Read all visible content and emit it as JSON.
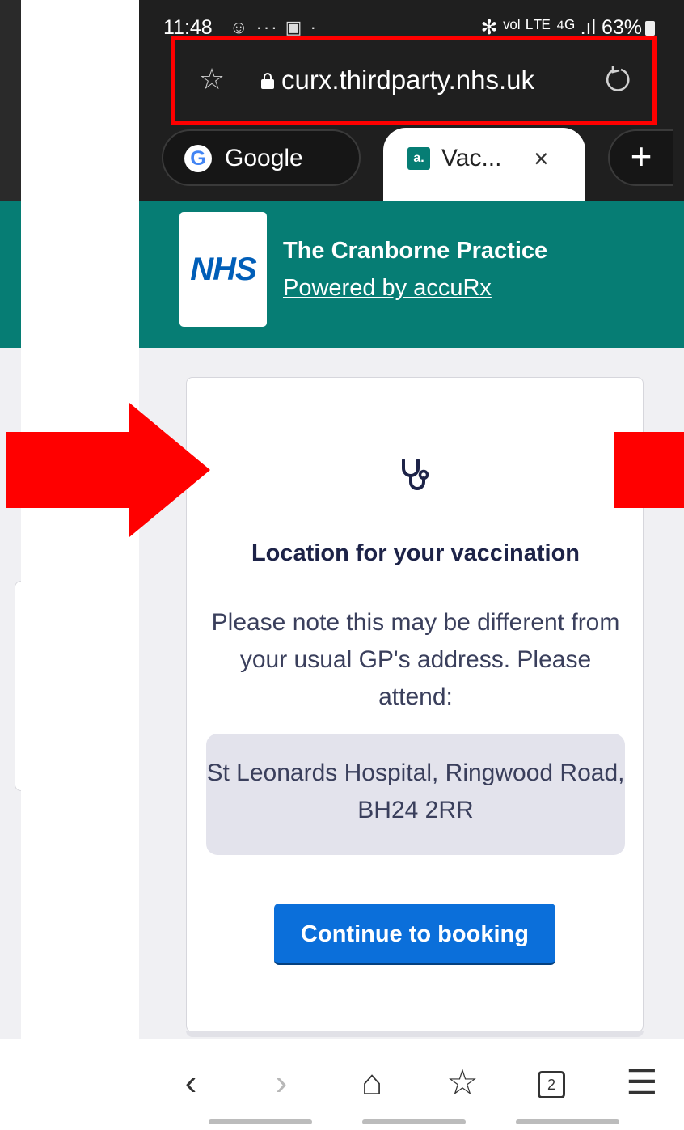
{
  "status_bar": {
    "time": "11:48",
    "extra_icons": "☺ ··· ▣ ·",
    "right": "✻ ᵛᵒˡ ᴸᵀᴱ ⁴ᴳ .ıl 63%"
  },
  "browser": {
    "url": "curx.thirdparty.nhs.uk",
    "tabs": [
      {
        "label": "Google",
        "icon": "google-icon"
      },
      {
        "label": "Vac...",
        "icon": "accurx-favicon",
        "close": "×"
      }
    ],
    "new_tab": "+",
    "google_glyph": "G",
    "accurx_glyph": "a."
  },
  "header": {
    "logo": "NHS",
    "practice": "The Cranborne Practice",
    "powered_by": "Powered by accuRx"
  },
  "card": {
    "title": "Location for your vaccination",
    "description": "Please note this may be different from your usual GP's address. Please attend:",
    "address": "St Leonards Hospital, Ringwood Road, BH24 2RR",
    "button": "Continue to booking"
  },
  "nav": {
    "back": "‹",
    "forward": "›",
    "home": "⌂",
    "bookmarks": "☆",
    "tabs_count": "2",
    "menu": "☰"
  },
  "colors": {
    "nhs_teal": "#067d74",
    "nhs_blue": "#005eb8",
    "button_blue": "#0b6fda",
    "highlight_red": "#ff0000"
  }
}
